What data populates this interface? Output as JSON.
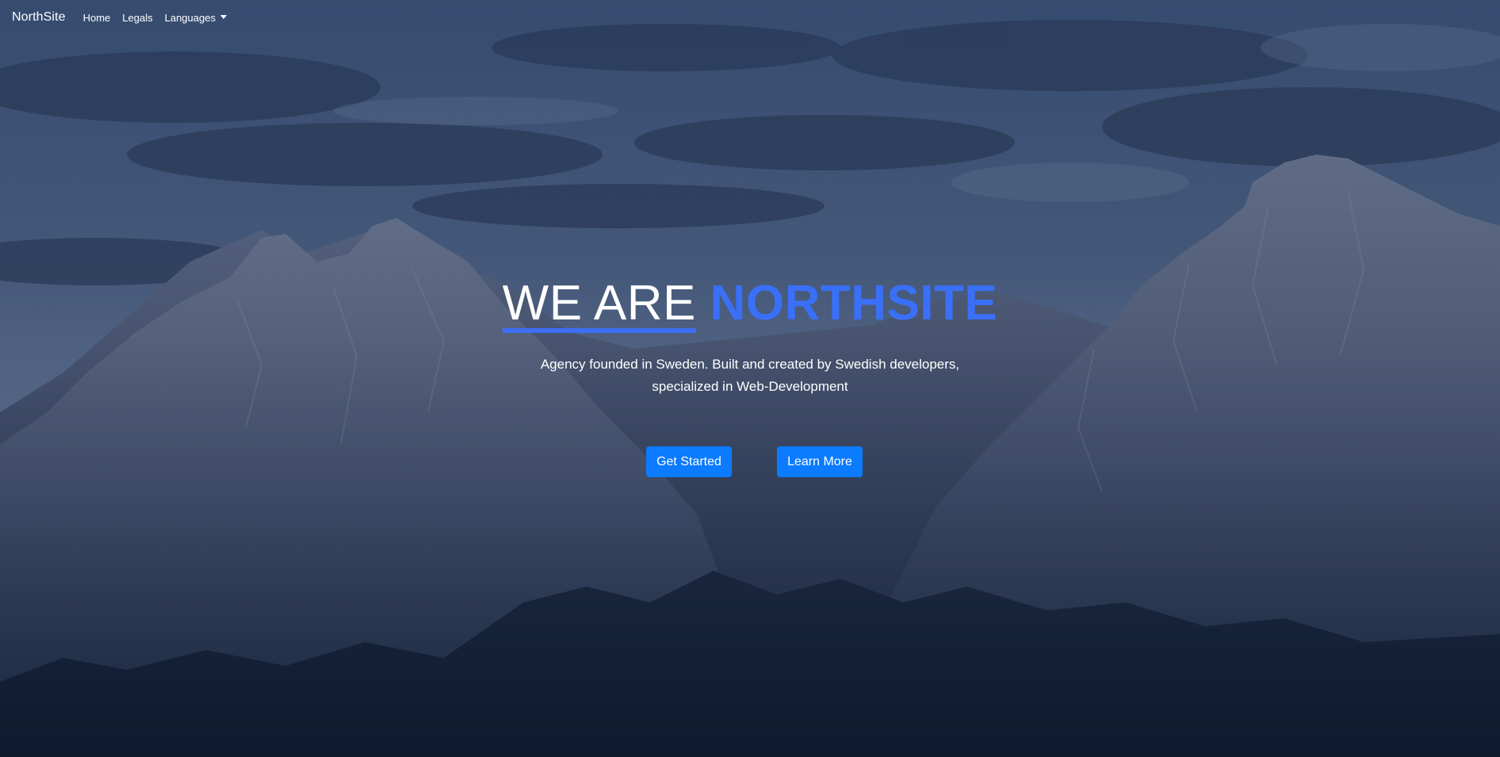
{
  "navbar": {
    "brand": "NorthSite",
    "links": {
      "home": "Home",
      "legals": "Legals",
      "languages": "Languages"
    }
  },
  "hero": {
    "headline_part1": "WE ARE",
    "headline_part2": "NORTHSITE",
    "tagline_line1": "Agency founded in Sweden. Built and created by Swedish developers,",
    "tagline_line2": "specialized in Web-Development",
    "buttons": {
      "get_started": "Get Started",
      "learn_more": "Learn More"
    }
  },
  "colors": {
    "accent": "#3a6ff7",
    "button": "#0b7bff",
    "text": "#ffffff"
  },
  "icons": {
    "languages_dropdown": "caret-down-icon"
  }
}
